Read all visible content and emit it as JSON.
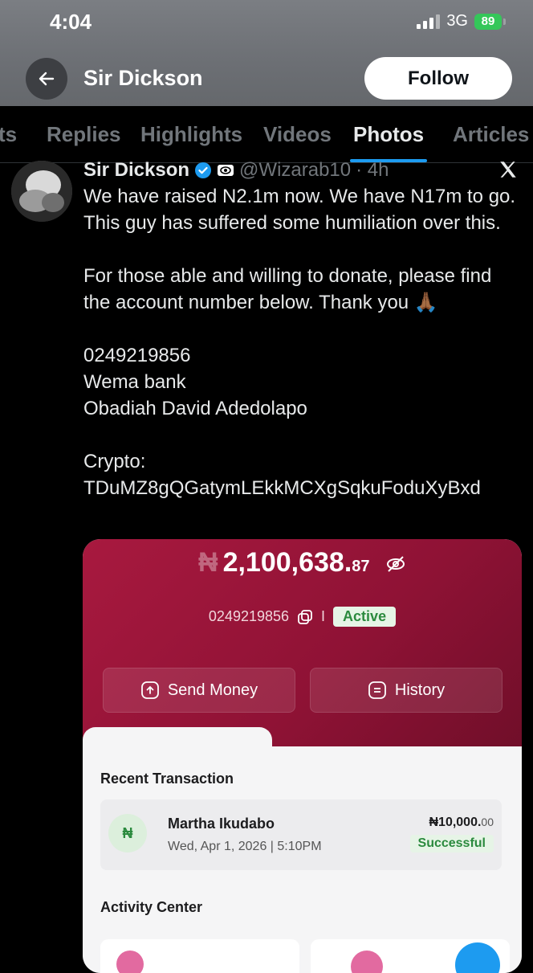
{
  "status_bar": {
    "time": "4:04",
    "network": "3G",
    "battery": "89"
  },
  "nav": {
    "title": "Sir Dickson",
    "follow_label": "Follow",
    "back_icon": "arrow-left-icon"
  },
  "tabs": [
    {
      "label": "ts"
    },
    {
      "label": "Replies"
    },
    {
      "label": "Highlights"
    },
    {
      "label": "Videos"
    },
    {
      "label": "Photos",
      "active": true
    },
    {
      "label": "Articles"
    }
  ],
  "tweet": {
    "author": "Sir Dickson",
    "handle": "@Wizarab10",
    "time": "· 4h",
    "text": "We have raised N2.1m now. We have N17m to go. This guy has suffered some humiliation over this.\n\nFor those able and willing to donate, please find the account number below. Thank you 🙏🏾\n\n0249219856\nWema bank\nObadiah David Adedolapo\n\nCrypto:\nTDuMZ8gQGatymLEkkMCXgSqkuFoduXyBxd"
  },
  "banking_screenshot": {
    "currency_symbol": "₦",
    "balance_main": "2,100,638.",
    "balance_cents": "87",
    "account_number": "0249219856",
    "separator": "I",
    "status": "Active",
    "send_money_label": "Send Money",
    "history_label": "History",
    "recent_title": "Recent Transaction",
    "transaction": {
      "icon_label": "₦",
      "name": "Martha Ikudabo",
      "date": "Wed, Apr 1, 2026 | 5:10PM",
      "amount_main": "₦10,000.",
      "amount_cents": "00",
      "status": "Successful"
    },
    "activity_title": "Activity Center"
  },
  "colors": {
    "accent": "#1d9bf0",
    "banner": "#a8193f",
    "success": "#2b8a3e"
  }
}
